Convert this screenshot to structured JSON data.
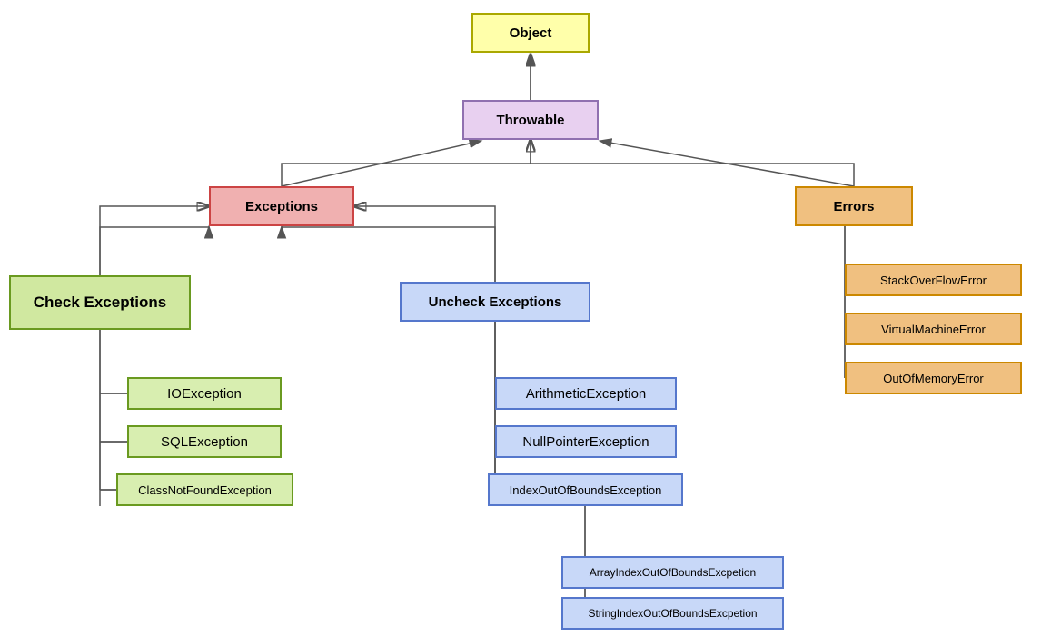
{
  "nodes": {
    "object": {
      "label": "Object"
    },
    "throwable": {
      "label": "Throwable"
    },
    "exceptions": {
      "label": "Exceptions"
    },
    "errors": {
      "label": "Errors"
    },
    "check": {
      "label": "Check Exceptions"
    },
    "uncheck": {
      "label": "Uncheck Exceptions"
    },
    "ioexception": {
      "label": "IOException"
    },
    "sqlexception": {
      "label": "SQLException"
    },
    "classnotfound": {
      "label": "ClassNotFoundException"
    },
    "arithmetic": {
      "label": "ArithmeticException"
    },
    "nullpointer": {
      "label": "NullPointerException"
    },
    "indexoutofbounds": {
      "label": "IndexOutOfBoundsException"
    },
    "arrayindex": {
      "label": "ArrayIndexOutOfBoundsExcpetion"
    },
    "stringindex": {
      "label": "StringIndexOutOfBoundsExcpetion"
    },
    "stackoverflow": {
      "label": "StackOverFlowError"
    },
    "virtualmachine": {
      "label": "VirtualMachineError"
    },
    "outofmemory": {
      "label": "OutOfMemoryError"
    }
  }
}
